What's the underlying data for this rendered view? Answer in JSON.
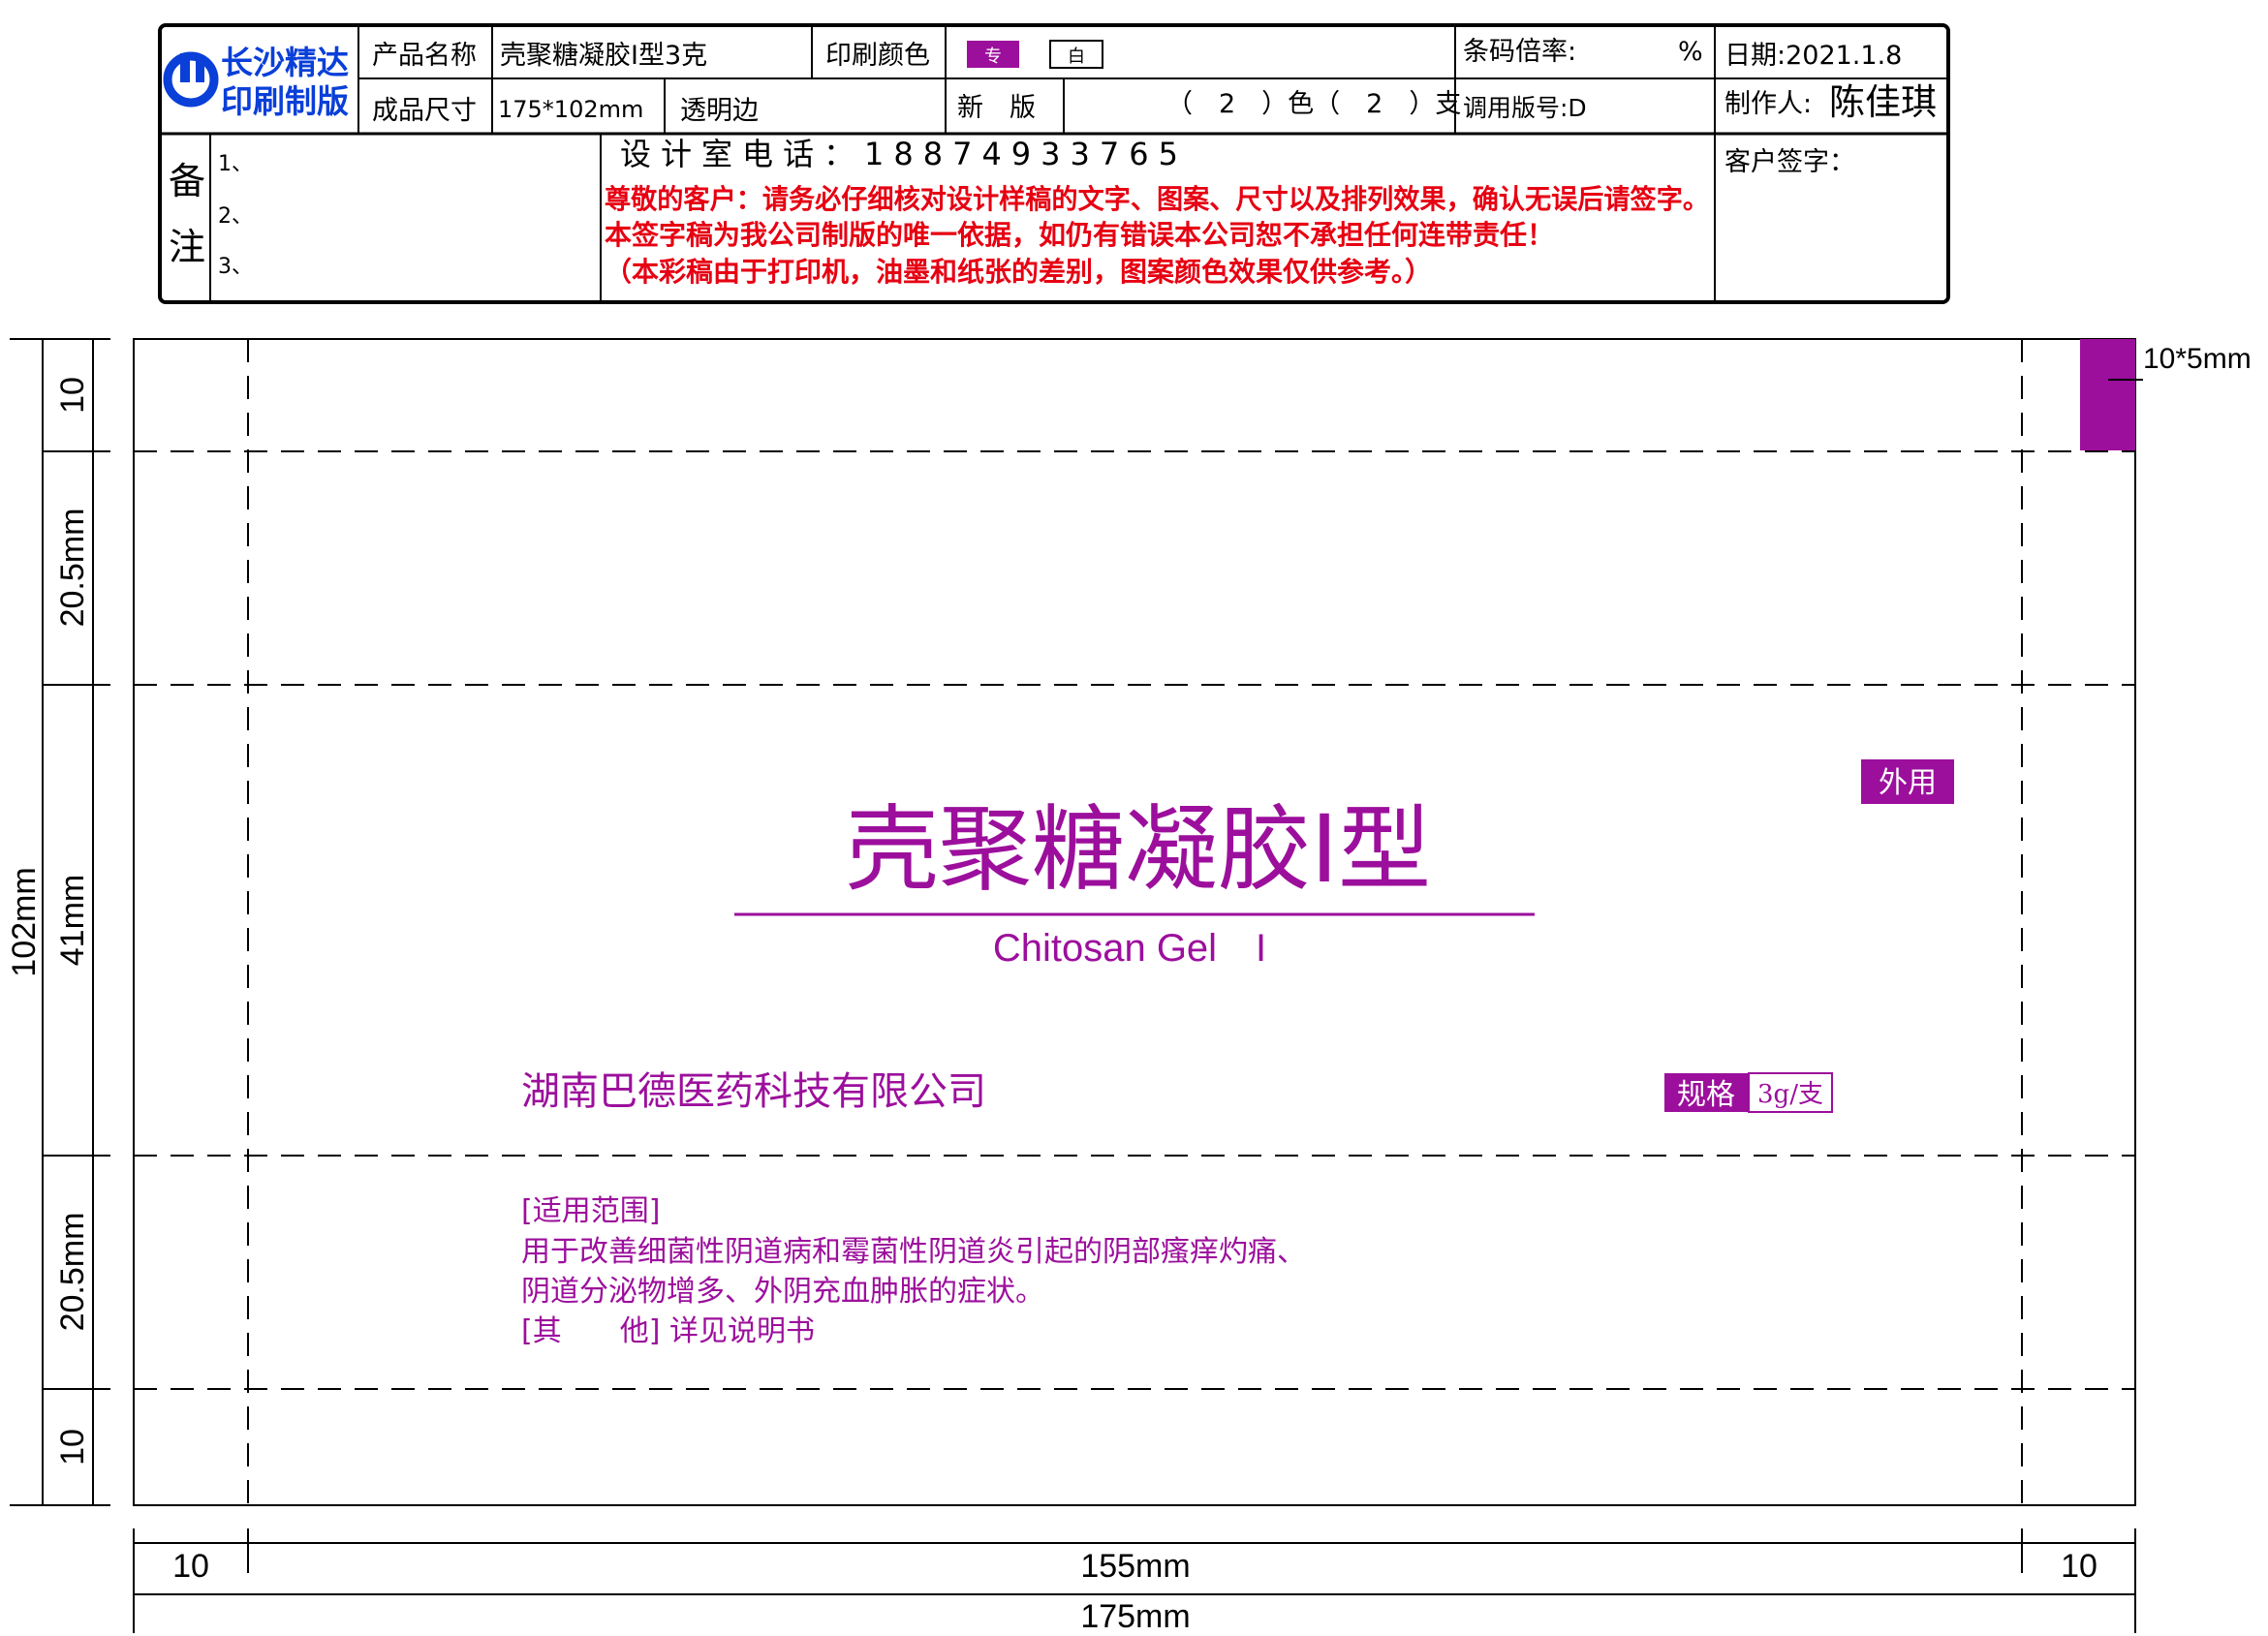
{
  "colors": {
    "magenta": "#9c0f9c",
    "red": "#e60012",
    "logo_blue": "#0a3fd8",
    "black": "#000000"
  },
  "header": {
    "logo_line1": "长沙精达",
    "logo_line2": "印刷制版",
    "logo_icon": "company-logo-icon",
    "product_name_label": "产品名称",
    "product_name_value": "壳聚糖凝胶I型3克",
    "print_color_label": "印刷颜色",
    "color_chip_special": "专",
    "color_chip_white": "白",
    "barcode_ratio_label": "条码倍率:",
    "barcode_ratio_unit": "%",
    "date_label": "日期:2021.1.8",
    "size_label": "成品尺寸",
    "size_value": "175*102mm",
    "edge_value": "透明边",
    "new_label": "新　版",
    "colors_value": "（　2　）色（　2　）支",
    "plate_no": "调用版号:D",
    "maker_label": "制作人:",
    "maker_name": "陈佳琪",
    "notes_label_1": "备",
    "notes_label_2": "注",
    "note_1": "1、",
    "note_2": "2、",
    "note_3": "3、",
    "phone": "设计室电话：18874933765",
    "warning_1": "尊敬的客户：请务必仔细核对设计样稿的文字、图案、尺寸以及排列效果，确认无误后请签字。",
    "warning_2": "本签字稿为我公司制版的唯一依据，如仍有错误本公司恕不承担任何连带责任！",
    "warning_3": "（本彩稿由于打印机，油墨和纸张的差别，图案颜色效果仅供参考。）",
    "customer_sign": "客户签字："
  },
  "artwork": {
    "swatch_label": "10*5mm",
    "external_badge": "外用",
    "title_cn": "壳聚糖凝胶I型",
    "title_en": "Chitosan Gel　I",
    "company": "湖南巴德医药科技有限公司",
    "spec_label": "规格",
    "spec_value": "3g/支",
    "scope_heading": "[适用范围]",
    "scope_line_1": "用于改善细菌性阴道病和霉菌性阴道炎引起的阴部瘙痒灼痛、",
    "scope_line_2": "阴道分泌物增多、外阴充血肿胀的症状。",
    "other_line": "[其　　他] 详见说明书"
  },
  "dimensions": {
    "total_height": "102mm",
    "seg_top": "10",
    "seg_upper": "20.5mm",
    "seg_middle": "41mm",
    "seg_lower": "20.5mm",
    "seg_bottom": "10",
    "width_left": "10",
    "width_center": "155mm",
    "width_right": "10",
    "total_width": "175mm"
  }
}
